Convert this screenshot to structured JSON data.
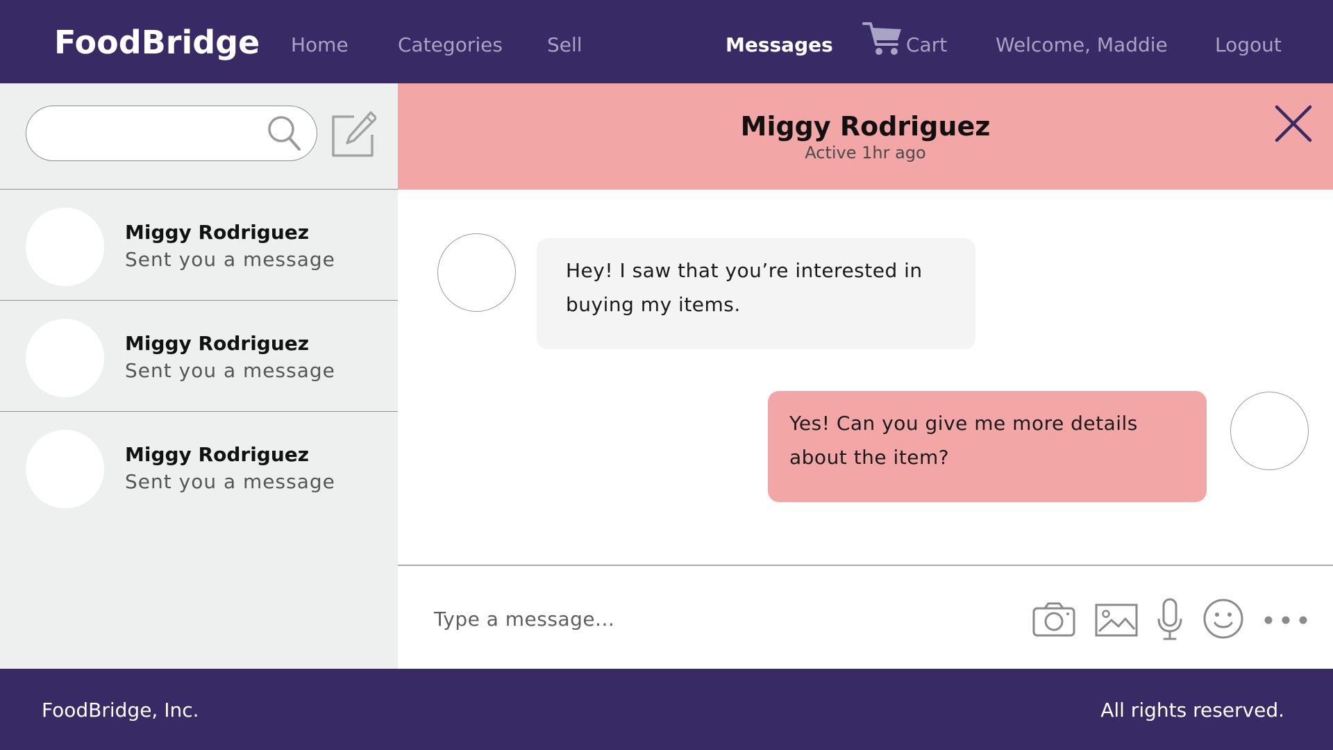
{
  "brand": {
    "name": "FoodBridge"
  },
  "nav": {
    "home": "Home",
    "categories": "Categories",
    "sell": "Sell",
    "messages": "Messages",
    "cart": "Cart",
    "welcome": "Welcome, Maddie",
    "logout": "Logout",
    "active_item": "Messages",
    "cart_icon": "shopping-cart-icon"
  },
  "sidebar": {
    "search": {
      "value": "",
      "icon": "search-icon"
    },
    "compose_icon": "compose-icon",
    "conversations": [
      {
        "name": "Miggy Rodriguez",
        "preview": "Sent you a message"
      },
      {
        "name": "Miggy Rodriguez",
        "preview": "Sent you a message"
      },
      {
        "name": "Miggy Rodriguez",
        "preview": "Sent you a message"
      }
    ]
  },
  "chat": {
    "contact_name": "Miggy Rodriguez",
    "status": "Active 1hr ago",
    "close_icon": "close-icon",
    "messages": [
      {
        "direction": "incoming",
        "line1": "Hey! I saw that you’re interested in",
        "line2": "buying my items."
      },
      {
        "direction": "outgoing",
        "line1": "Yes! Can you give me more details",
        "line2": "about the item?"
      }
    ]
  },
  "composer": {
    "placeholder": "Type a message...",
    "value": "",
    "tools": [
      "camera-icon",
      "image-icon",
      "microphone-icon",
      "emoji-icon",
      "more-icon"
    ]
  },
  "footer": {
    "left": "FoodBridge, Inc.",
    "right": "All rights reserved."
  },
  "colors": {
    "nav_bg": "#382a65",
    "accent_pink": "#f3a6a6",
    "sidebar_bg": "#eef0ef",
    "incoming_bubble": "#f3f4f3",
    "nav_inactive": "#a9a3c4"
  }
}
